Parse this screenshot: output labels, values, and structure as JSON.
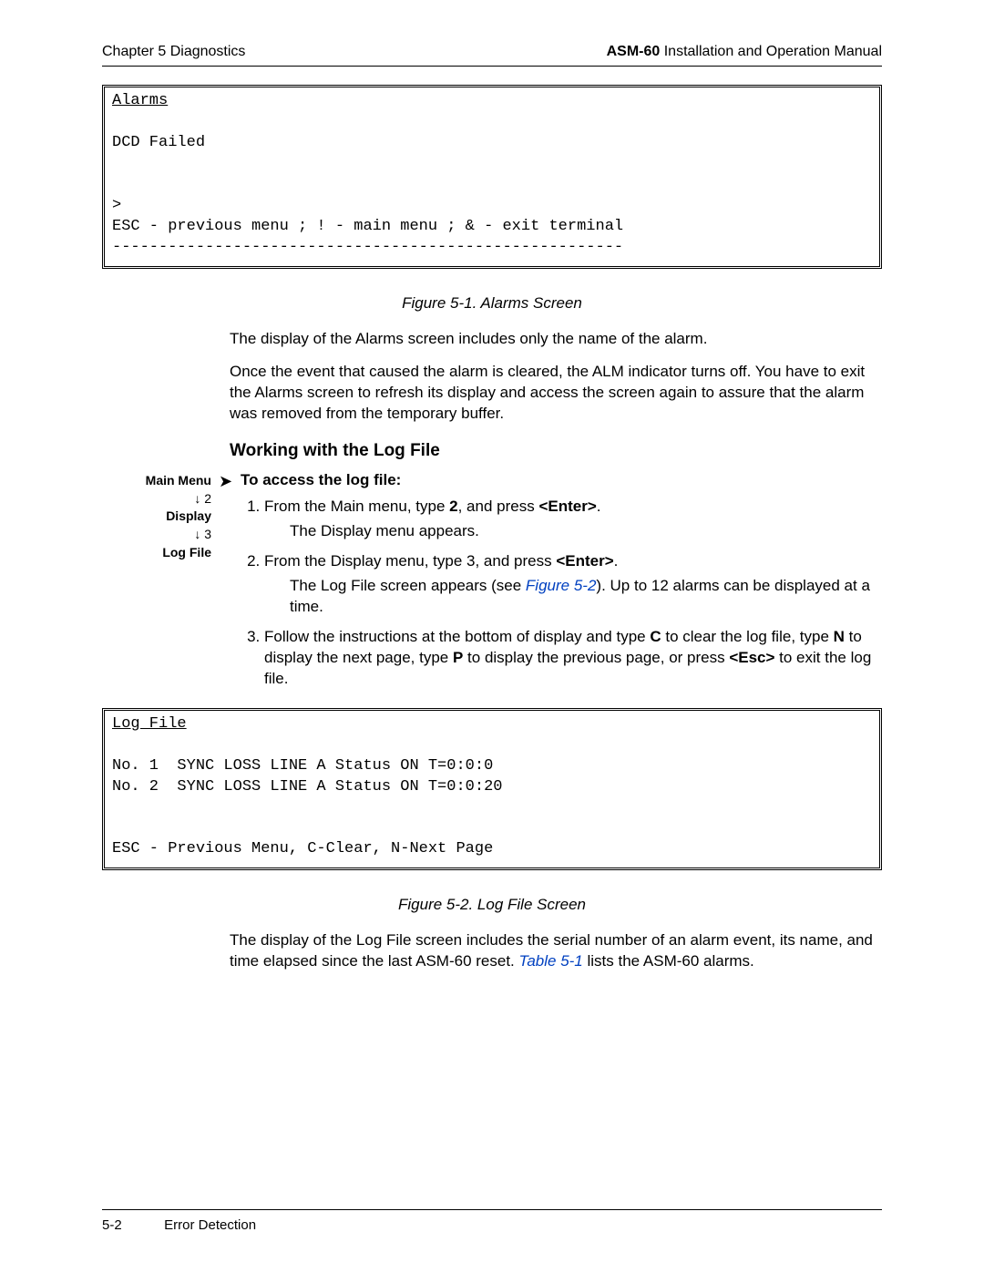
{
  "header": {
    "left": "Chapter 5  Diagnostics",
    "right_bold": "ASM-60",
    "right_rest": " Installation and Operation Manual"
  },
  "alarms_box": {
    "title": "Alarms",
    "line1": "DCD Failed",
    "prompt": ">",
    "nav": "ESC - previous menu ; ! - main menu ; & - exit terminal",
    "dashes": "-------------------------------------------------------"
  },
  "fig1_caption": "Figure 5-1.  Alarms Screen",
  "para1": "The display of the Alarms screen includes only the name of the alarm.",
  "para2": "Once the event that caused the alarm is cleared, the ALM indicator turns off. You have to exit the Alarms screen to refresh its display and access the screen again to assure that the alarm was removed from the temporary buffer.",
  "section_heading": "Working with the Log File",
  "sidenote": {
    "l1": "Main Menu",
    "l2": "↓ 2",
    "l3": "Display",
    "l4": "↓ 3",
    "l5": "Log File"
  },
  "proc_lead": "To access the log file:",
  "step1_a": "From the Main menu, type ",
  "step1_b": "2",
  "step1_c": ", and press ",
  "step1_d": "<Enter>",
  "step1_e": ".",
  "step1_sub": "The Display menu appears.",
  "step2_a": "From the Display menu, type 3, and press ",
  "step2_b": "<Enter>",
  "step2_c": ".",
  "step2_sub_a": "The Log File screen appears (see ",
  "step2_sub_link": "Figure 5-2",
  "step2_sub_b": "). Up to 12 alarms can be displayed at a time.",
  "step3_a": "Follow the instructions at the bottom of display and type ",
  "step3_b": "C",
  "step3_c": " to clear the log file, type ",
  "step3_d": "N",
  "step3_e": " to display the next page, type ",
  "step3_f": "P",
  "step3_g": " to display the previous page, or press ",
  "step3_h": "<Esc>",
  "step3_i": " to exit the log file.",
  "log_box": {
    "title": "Log File",
    "line1": "No. 1  SYNC LOSS LINE A Status ON T=0:0:0",
    "line2": "No. 2  SYNC LOSS LINE A Status ON T=0:0:20",
    "nav": "ESC - Previous Menu, C-Clear, N-Next Page"
  },
  "fig2_caption": "Figure 5-2.  Log File Screen",
  "para3_a": "The display of the Log File screen includes the serial number of an alarm event, its name, and time elapsed since the last ASM-60 reset. ",
  "para3_link": "Table 5-1",
  "para3_b": " lists the ASM-60 alarms.",
  "footer": {
    "page": "5-2",
    "section": "Error Detection"
  }
}
